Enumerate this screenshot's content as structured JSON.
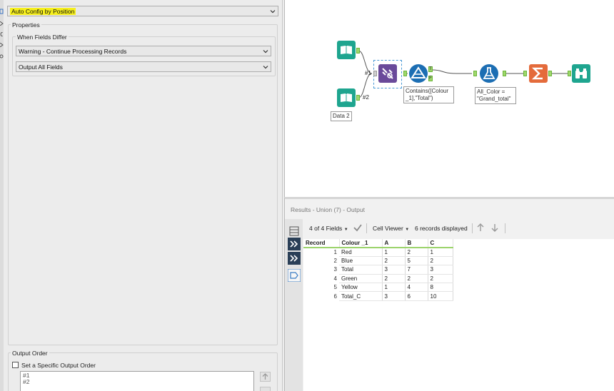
{
  "config": {
    "union_mode": "Auto Config by Position",
    "properties_label": "Properties",
    "fields_differ_label": "When Fields Differ",
    "fields_differ_value": "Warning - Continue Processing Records",
    "output_fields_value": "Output All Fields",
    "output_order_label": "Output Order",
    "specific_order_label": "Set a Specific Output Order",
    "order_items": [
      "#1",
      "#2"
    ]
  },
  "canvas": {
    "connection_labels": [
      "#1",
      "#2"
    ],
    "input_label": "Data 2",
    "filter_label": "Contains([Colour\n_1],\"Total\")",
    "formula_label": "All_Color =\n\"Grand_total\"",
    "filter_anchor_t": "T",
    "filter_anchor_f": "F"
  },
  "results": {
    "title": "Results - Union (7) - Output",
    "fields_summary": "4 of 4 Fields",
    "viewer": "Cell Viewer",
    "records_summary": "6 records displayed",
    "columns": [
      "Record",
      "Colour _1",
      "A",
      "B",
      "C"
    ],
    "rows": [
      [
        "1",
        "Red",
        "1",
        "2",
        "1"
      ],
      [
        "2",
        "Blue",
        "2",
        "5",
        "2"
      ],
      [
        "3",
        "Total",
        "3",
        "7",
        "3"
      ],
      [
        "4",
        "Green",
        "2",
        "2",
        "2"
      ],
      [
        "5",
        "Yellow",
        "1",
        "4",
        "8"
      ],
      [
        "6",
        "Total_C",
        "3",
        "6",
        "10"
      ]
    ]
  },
  "colors": {
    "input_tool": "#1ea58f",
    "union_tool": "#6a4a9a",
    "filter_tool": "#1c6eb3",
    "formula_tool": "#1c6eb3",
    "summarize_tool": "#e46b3b",
    "browse_tool": "#1ea58f",
    "highlight": "#f7f01c",
    "anchor": "#9fd86b"
  }
}
